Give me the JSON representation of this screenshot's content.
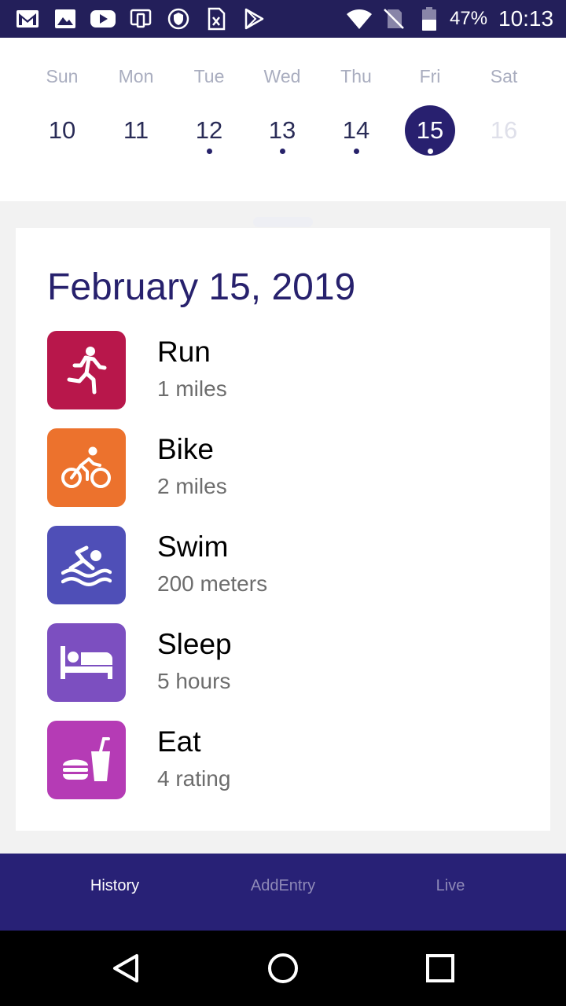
{
  "status_bar": {
    "battery_percent": "47%",
    "time": "10:13",
    "icons": [
      "gmail-icon",
      "photos-icon",
      "youtube-icon",
      "device-icon",
      "vpn-icon",
      "sim-icon",
      "play-store-icon",
      "wifi-icon",
      "no-signal-icon",
      "battery-icon"
    ]
  },
  "calendar": {
    "days": [
      {
        "name": "Sun",
        "number": "10",
        "has_entry": false,
        "selected": false,
        "disabled": false
      },
      {
        "name": "Mon",
        "number": "11",
        "has_entry": false,
        "selected": false,
        "disabled": false
      },
      {
        "name": "Tue",
        "number": "12",
        "has_entry": true,
        "selected": false,
        "disabled": false
      },
      {
        "name": "Wed",
        "number": "13",
        "has_entry": true,
        "selected": false,
        "disabled": false
      },
      {
        "name": "Thu",
        "number": "14",
        "has_entry": true,
        "selected": false,
        "disabled": false
      },
      {
        "name": "Fri",
        "number": "15",
        "has_entry": true,
        "selected": true,
        "disabled": false
      },
      {
        "name": "Sat",
        "number": "16",
        "has_entry": false,
        "selected": false,
        "disabled": true
      }
    ]
  },
  "card": {
    "date": "February 15, 2019",
    "entries": [
      {
        "label": "Run",
        "value": "1 miles",
        "icon": "running-icon",
        "color": "#b8174b"
      },
      {
        "label": "Bike",
        "value": "2 miles",
        "icon": "bike-icon",
        "color": "#ec722d"
      },
      {
        "label": "Swim",
        "value": "200 meters",
        "icon": "swim-icon",
        "color": "#4f4fb7"
      },
      {
        "label": "Sleep",
        "value": "5 hours",
        "icon": "bed-icon",
        "color": "#7c4fc0"
      },
      {
        "label": "Eat",
        "value": "4 rating",
        "icon": "food-icon",
        "color": "#b53bb5"
      }
    ]
  },
  "tabs": [
    {
      "label": "History",
      "active": true
    },
    {
      "label": "AddEntry",
      "active": false
    },
    {
      "label": "Live",
      "active": false
    }
  ],
  "colors": {
    "primary": "#28206f",
    "status_bar": "#231f5a",
    "tab_bar": "#282176"
  }
}
